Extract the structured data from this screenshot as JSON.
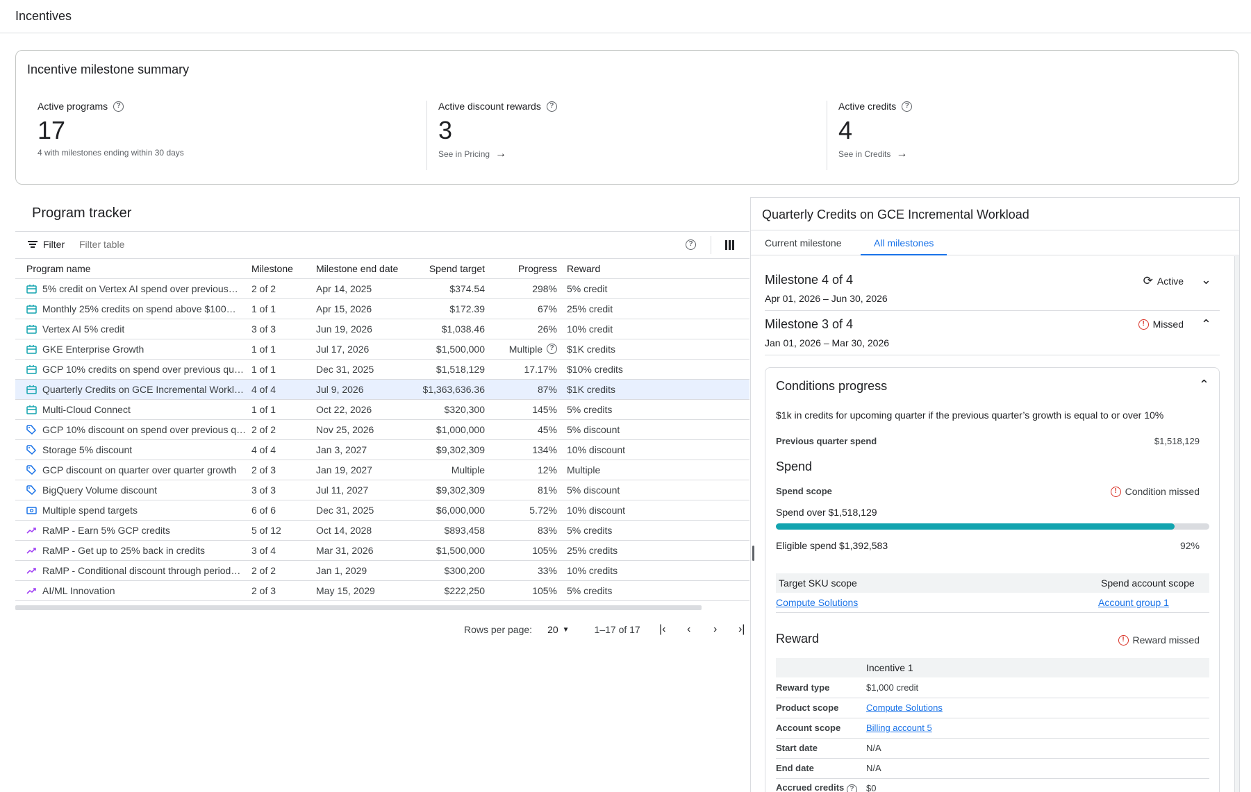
{
  "page": {
    "title": "Incentives"
  },
  "summary": {
    "title": "Incentive milestone summary",
    "metrics": [
      {
        "label": "Active programs",
        "value": "17",
        "sub": "4 with milestones ending within 30 days"
      },
      {
        "label": "Active discount rewards",
        "value": "3",
        "sub": "See in Pricing"
      },
      {
        "label": "Active credits",
        "value": "4",
        "sub": "See in Credits"
      }
    ]
  },
  "tracker": {
    "title": "Program tracker",
    "filter_label": "Filter",
    "filter_placeholder": "Filter table",
    "columns": [
      "Program name",
      "Milestone",
      "Milestone end date",
      "Spend target",
      "Progress",
      "Reward"
    ],
    "rows": [
      {
        "icon": "gift-card-icon",
        "name": "5% credit on Vertex AI spend over previous…",
        "milestone": "2 of 2",
        "end": "Apr 14, 2025",
        "spend": "$374.54",
        "progress": "298%",
        "reward": "5% credit"
      },
      {
        "icon": "gift-card-icon",
        "name": "Monthly 25% credits on spend above $100…",
        "milestone": "1 of 1",
        "end": "Apr 15, 2026",
        "spend": "$172.39",
        "progress": "67%",
        "reward": "25% credit"
      },
      {
        "icon": "gift-card-icon",
        "name": "Vertex AI 5% credit",
        "milestone": "3 of 3",
        "end": "Jun 19, 2026",
        "spend": "$1,038.46",
        "progress": "26%",
        "reward": "10% credit"
      },
      {
        "icon": "gift-card-icon",
        "name": "GKE Enterprise Growth",
        "milestone": "1 of 1",
        "end": "Jul 17, 2026",
        "spend": "$1,500,000",
        "progress": "Multiple",
        "reward": "$1K credits"
      },
      {
        "icon": "gift-card-icon",
        "name": "GCP 10% credits on spend over previous qua…",
        "milestone": "1 of 1",
        "end": "Dec 31, 2025",
        "spend": "$1,518,129",
        "progress": "17.17%",
        "reward": "$10% credits"
      },
      {
        "icon": "gift-card-icon",
        "name": "Quarterly Credits on GCE Incremental Workl…",
        "milestone": "4 of 4",
        "end": "Jul 9, 2026",
        "spend": "$1,363,636.36",
        "progress": "87%",
        "reward": "$1K credits"
      },
      {
        "icon": "gift-card-icon",
        "name": "Multi-Cloud Connect",
        "milestone": "1 of 1",
        "end": "Oct 22, 2026",
        "spend": "$320,300",
        "progress": "145%",
        "reward": "5% credits"
      },
      {
        "icon": "tag-icon",
        "name": "GCP 10% discount on spend over previous q…",
        "milestone": "2 of 2",
        "end": "Nov 25, 2026",
        "spend": "$1,000,000",
        "progress": "45%",
        "reward": "5% discount"
      },
      {
        "icon": "tag-icon",
        "name": " Storage 5% discount",
        "milestone": "4 of 4",
        "end": "Jan 3, 2027",
        "spend": "$9,302,309",
        "progress": "134%",
        "reward": "10% discount"
      },
      {
        "icon": "tag-icon",
        "name": "GCP discount on quarter over quarter growth",
        "milestone": "2 of 3",
        "end": "Jan 19, 2027",
        "spend": "Multiple",
        "progress": "12%",
        "reward": "Multiple"
      },
      {
        "icon": "tag-icon",
        "name": "BigQuery Volume discount",
        "milestone": "3 of 3",
        "end": "Jul 11, 2027",
        "spend": "$9,302,309",
        "progress": "81%",
        "reward": "5% discount"
      },
      {
        "icon": "money-icon",
        "name": "Multiple spend targets",
        "milestone": "6 of 6",
        "end": "Dec 31, 2025",
        "spend": "$6,000,000",
        "progress": "5.72%",
        "reward": "10% discount"
      },
      {
        "icon": "trending-up-icon",
        "name": "RaMP - Earn 5% GCP credits",
        "milestone": "5 of 12",
        "end": "Oct 14, 2028",
        "spend": "$893,458",
        "progress": "83%",
        "reward": "5% credits"
      },
      {
        "icon": "trending-up-icon",
        "name": "RaMP - Get up to 25% back in credits",
        "milestone": "3 of 4",
        "end": "Mar 31, 2026",
        "spend": "$1,500,000",
        "progress": "105%",
        "reward": "25% credits"
      },
      {
        "icon": "trending-up-icon",
        "name": "RaMP - Conditional discount through period…",
        "milestone": "2 of 2",
        "end": "Jan 1, 2029",
        "spend": "$300,200",
        "progress": "33%",
        "reward": "10% credits"
      },
      {
        "icon": "trending-up-icon",
        "name": "AI/ML Innovation",
        "milestone": " 2 of 3",
        "end": "May 15, 2029",
        "spend": "$222,250",
        "progress": "105%",
        "reward": "5% credits"
      }
    ],
    "pagination": {
      "rows_label": "Rows per page:",
      "rows_value": "20",
      "range": "1–17 of 17"
    }
  },
  "detail": {
    "title": "Quarterly Credits on GCE Incremental Workload",
    "tabs": [
      "Current milestone",
      "All milestones"
    ],
    "active_tab": "All milestones",
    "milestones": [
      {
        "title": "Milestone 4 of 4",
        "dates": "Apr 01, 2026 – Jun 30, 2026",
        "status": "Active"
      },
      {
        "title": "Milestone 3 of 4",
        "dates": "Jan 01, 2026 – Mar 30, 2026",
        "status": "Missed"
      }
    ],
    "conditions": {
      "title": "Conditions progress",
      "description": "$1k in credits for upcoming quarter if the previous quarter’s growth is equal to or over 10%",
      "prev_label": "Previous quarter spend",
      "prev_value": "$1,518,129",
      "spend_title": "Spend",
      "scope_label": "Spend scope",
      "scope_status": "Condition missed",
      "spend_over": "Spend  over $1,518,129",
      "progress_fraction": 0.92,
      "eligible": "Eligible spend  $1,392,583",
      "eligible_pct": "92%",
      "scope_cols": [
        "Target SKU scope",
        "Spend account scope"
      ],
      "scope_vals": [
        "Compute Solutions",
        "Account group 1"
      ],
      "reward_title": "Reward",
      "reward_status": "Reward missed",
      "reward_col": "Incentive 1",
      "reward_rows": [
        {
          "k": "Reward type",
          "v": "$1,000 credit"
        },
        {
          "k": "Product scope",
          "v": "Compute Solutions"
        },
        {
          "k": "Account scope",
          "v": "Billing account 5"
        },
        {
          "k": "Start date",
          "v": "N/A"
        },
        {
          "k": "End date",
          "v": "N/A"
        },
        {
          "k": "Accrued credits",
          "v": "$0"
        }
      ]
    }
  }
}
